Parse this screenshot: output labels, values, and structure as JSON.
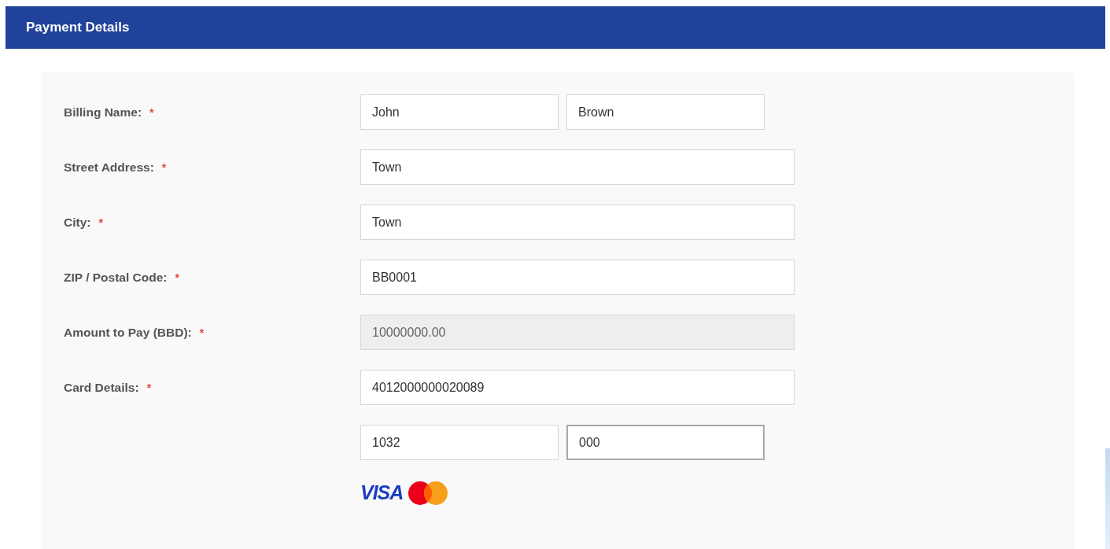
{
  "header": {
    "title": "Payment Details"
  },
  "rows": [
    {
      "label": "Billing Name:",
      "required": "*",
      "fields": [
        {
          "value": "John",
          "disabled": false,
          "focused": false
        },
        {
          "value": "Brown",
          "disabled": false,
          "focused": false
        }
      ]
    },
    {
      "label": "Street Address:",
      "required": "*",
      "fields": [
        {
          "value": "Town",
          "disabled": false,
          "focused": false
        }
      ]
    },
    {
      "label": "City:",
      "required": "*",
      "fields": [
        {
          "value": "Town",
          "disabled": false,
          "focused": false
        }
      ]
    },
    {
      "label": "ZIP / Postal Code:",
      "required": "*",
      "fields": [
        {
          "value": "BB0001",
          "disabled": false,
          "focused": false
        }
      ]
    },
    {
      "label": "Amount to Pay (BBD):",
      "required": "*",
      "fields": [
        {
          "value": "10000000.00",
          "disabled": true,
          "focused": false
        }
      ]
    },
    {
      "label": "Card Details:",
      "required": "*",
      "fields": [
        {
          "value": "4012000000020089",
          "disabled": false,
          "focused": false
        }
      ]
    },
    {
      "fields": [
        {
          "value": "1032",
          "disabled": false,
          "focused": false
        },
        {
          "value": "000",
          "disabled": false,
          "focused": true
        }
      ]
    }
  ],
  "card_brands": [
    {
      "kind": "visa",
      "label": "VISA"
    },
    {
      "kind": "mastercard"
    }
  ]
}
